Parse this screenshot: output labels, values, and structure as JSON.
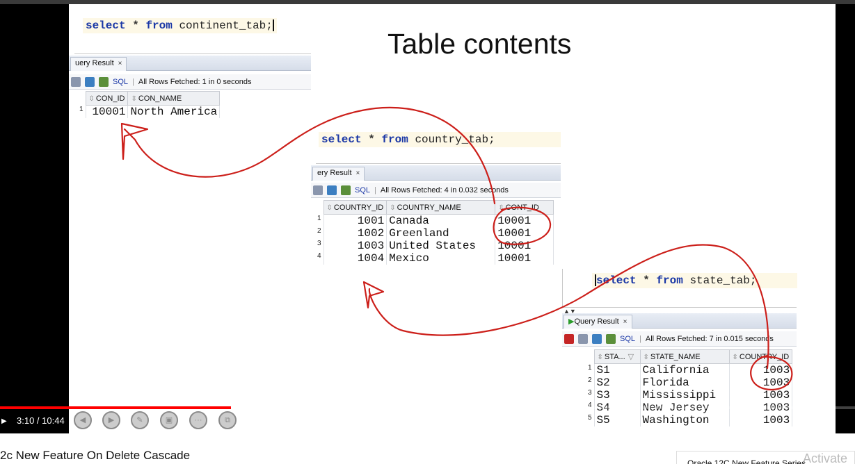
{
  "slide": {
    "title": "Table contents",
    "continent": {
      "sql": {
        "kw_select": "select",
        "star": "*",
        "kw_from": "from",
        "table": "continent_tab;"
      },
      "tab_label": "uery Result",
      "close": "×",
      "sql_label": "SQL",
      "status": "All Rows Fetched: 1 in 0 seconds",
      "columns": [
        "CON_ID",
        "CON_NAME"
      ],
      "rows": [
        {
          "n": "1",
          "c1": "10001",
          "c2": "North America"
        }
      ]
    },
    "country": {
      "sql": {
        "kw_select": "select",
        "star": "*",
        "kw_from": "from",
        "table": "country_tab;"
      },
      "tab_label": "ery Result",
      "close": "×",
      "sql_label": "SQL",
      "status": "All Rows Fetched: 4 in 0.032 seconds",
      "columns": [
        "COUNTRY_ID",
        "COUNTRY_NAME",
        "CONT_ID"
      ],
      "rows": [
        {
          "n": "1",
          "c1": "1001",
          "c2": "Canada",
          "c3": "10001"
        },
        {
          "n": "2",
          "c1": "1002",
          "c2": "Greenland",
          "c3": "10001"
        },
        {
          "n": "3",
          "c1": "1003",
          "c2": "United States",
          "c3": "10001"
        },
        {
          "n": "4",
          "c1": "1004",
          "c2": "Mexico",
          "c3": "10001"
        }
      ]
    },
    "state": {
      "sql": {
        "kw_select": "select",
        "star": "*",
        "kw_from": "from",
        "table": "state_tab;"
      },
      "tab_label": "Query Result",
      "close": "×",
      "sql_label": "SQL",
      "status": "All Rows Fetched: 7 in 0.015 seconds",
      "columns": [
        "STA...",
        "STATE_NAME",
        "COUNTRY_ID"
      ],
      "rows": [
        {
          "n": "1",
          "c1": "S1",
          "c2": "California",
          "c3": "1003"
        },
        {
          "n": "2",
          "c1": "S2",
          "c2": "Florida",
          "c3": "1003"
        },
        {
          "n": "3",
          "c1": "S3",
          "c2": "Mississippi",
          "c3": "1003"
        },
        {
          "n": "4",
          "c1": "S4",
          "c2": "New Jersey",
          "c3": "1003"
        },
        {
          "n": "5",
          "c1": "S5",
          "c2": "Washington",
          "c3": "1003"
        }
      ]
    }
  },
  "player": {
    "time": "3:10 / 10:44",
    "progress_fraction": 0.27,
    "buffer_fraction": 0.3,
    "colors": {
      "progress": "#ff0000",
      "annotation": "#cc1f1a",
      "keyword": "#1a37a6"
    },
    "icons": [
      "play-icon",
      "chapter-prev-icon",
      "chapter-next-icon",
      "annotate-icon",
      "camera-icon",
      "more-icon",
      "screen-icon"
    ]
  },
  "video": {
    "title": "2c New Feature On Delete Cascade",
    "next_card_title": "Oracle 12C New Feature Series"
  },
  "watermark": "Activate"
}
